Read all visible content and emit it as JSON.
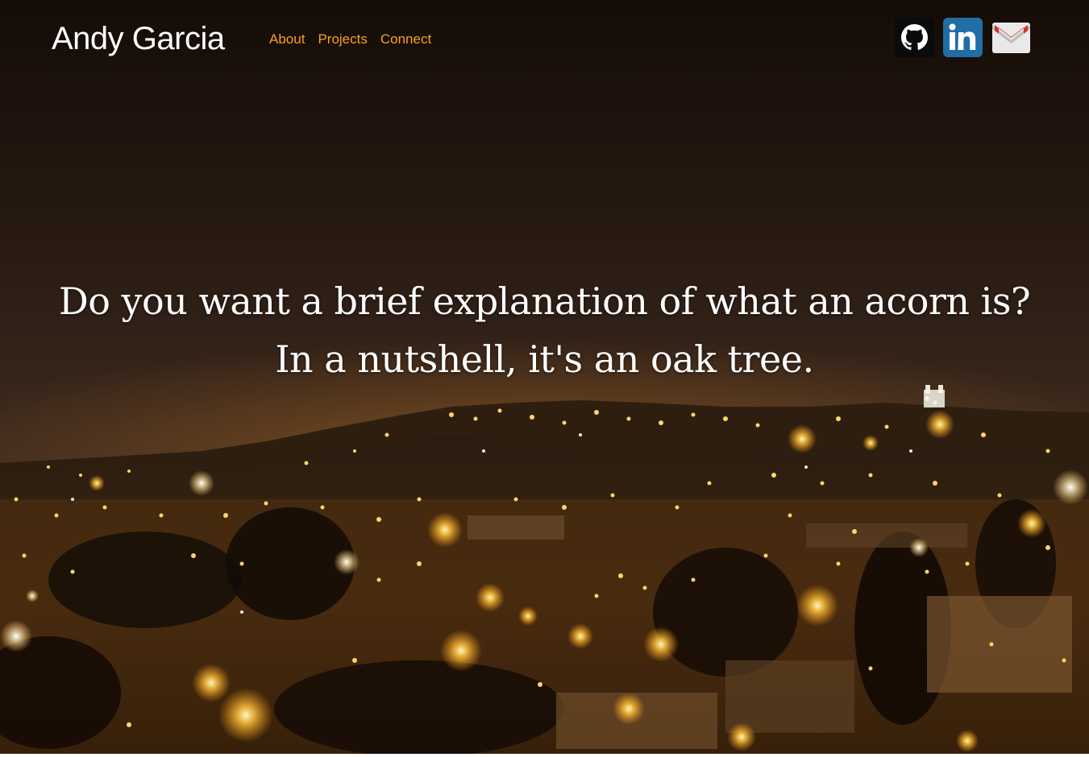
{
  "header": {
    "brand": "Andy Garcia",
    "nav": [
      {
        "label": "About"
      },
      {
        "label": "Projects"
      },
      {
        "label": "Connect"
      }
    ],
    "social": [
      {
        "icon": "github-icon"
      },
      {
        "icon": "linkedin-icon"
      },
      {
        "icon": "gmail-icon"
      }
    ]
  },
  "hero": {
    "quote": "Do you want a brief explanation of what an acorn is? In a nutshell, it's an oak tree.",
    "background": "night-city-lights-photo"
  },
  "colors": {
    "nav_link": "#f6a21e",
    "brand": "#ffffff",
    "quote": "#ffffff",
    "sky": "#2a1a10"
  }
}
